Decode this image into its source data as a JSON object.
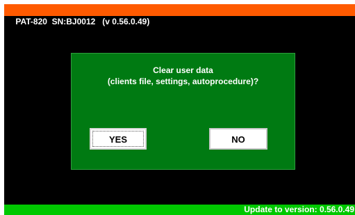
{
  "title_bar": {
    "text": "PAT-820  SN:BJ0012   (v 0.56.0.49)"
  },
  "dialog": {
    "message_line1": "Clear user data",
    "message_line2": "(clients file, settings, autoprocedure)?",
    "yes_label": "YES",
    "no_label": "NO"
  },
  "status_bar": {
    "text": "Update to version: 0.56.0.49"
  },
  "colors": {
    "title_bar": "#ff5a00",
    "screen_background": "#000000",
    "dialog_background": "#007a12",
    "status_bar": "#00c800",
    "button_background": "#ffffff"
  }
}
